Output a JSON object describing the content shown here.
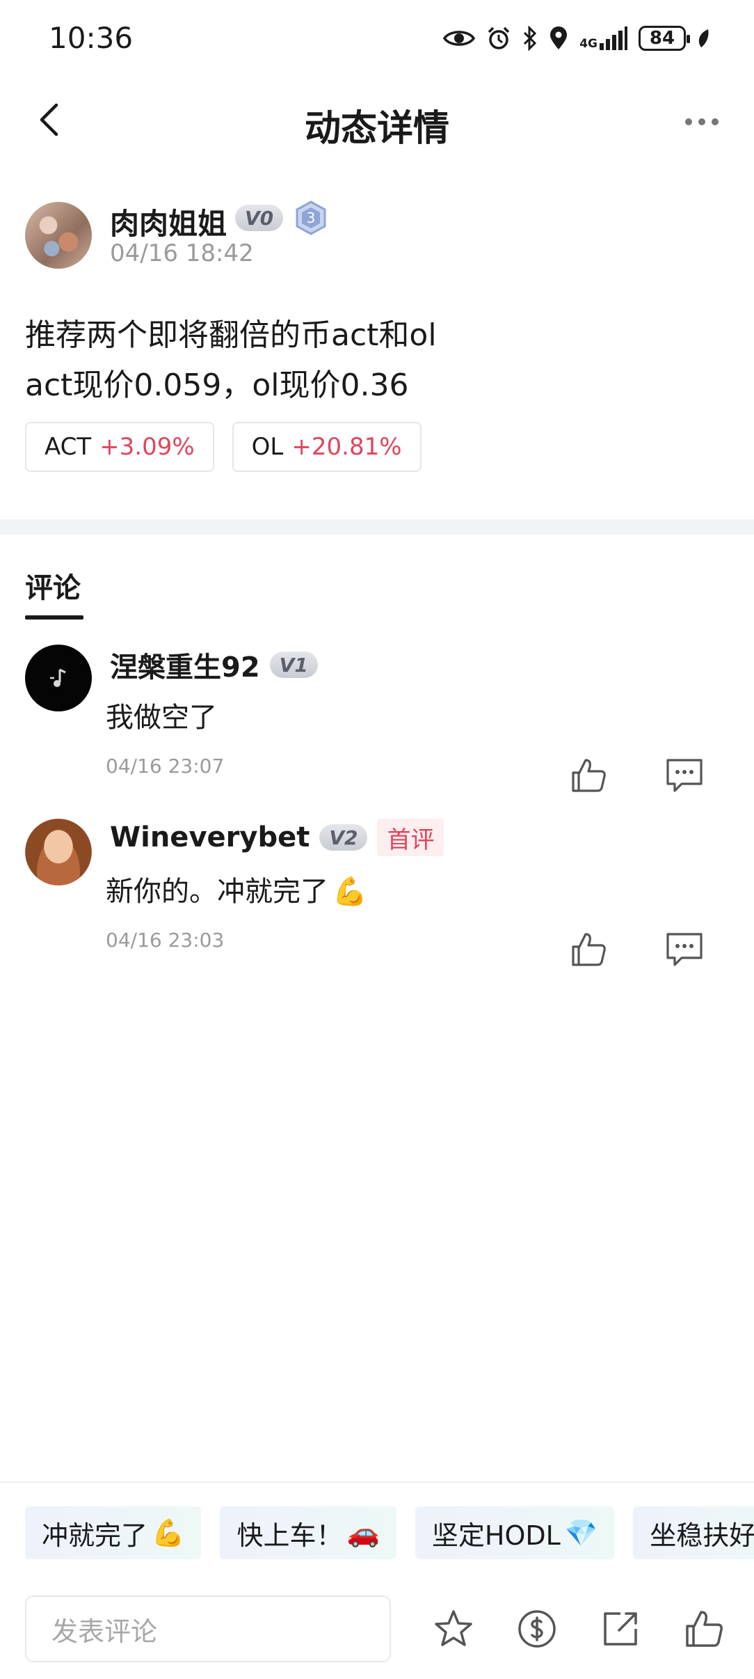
{
  "status": {
    "time": "10:36",
    "network": "4G",
    "battery": "84"
  },
  "header": {
    "title": "动态详情"
  },
  "post": {
    "author": {
      "name": "肉肉姐姐",
      "level": "V0",
      "rank": "3",
      "time": "04/16 18:42"
    },
    "lines": [
      "推荐两个即将翻倍的币act和ol",
      "act现价0.059，ol现价0.36"
    ],
    "tickers": [
      {
        "symbol": "ACT",
        "change": "+3.09%"
      },
      {
        "symbol": "OL",
        "change": "+20.81%"
      }
    ]
  },
  "comments_section": {
    "tab_label": "评论",
    "items": [
      {
        "name": "涅槃重生92",
        "level": "V1",
        "tag": "",
        "text": "我做空了",
        "time": "04/16 23:07"
      },
      {
        "name": "Wineverybet",
        "level": "V2",
        "tag": "首评",
        "text": "新你的。冲就完了",
        "emoji": "💪",
        "time": "04/16 23:03"
      }
    ]
  },
  "quick_replies": [
    {
      "text": "冲就完了",
      "emoji": "💪"
    },
    {
      "text": "快上车！",
      "emoji": "🚗"
    },
    {
      "text": "坚定HODL",
      "emoji": "💎"
    },
    {
      "text": "坐稳扶好",
      "emoji": ""
    }
  ],
  "bottom_bar": {
    "placeholder": "发表评论",
    "icons": [
      "star-icon",
      "coin-icon",
      "share-icon",
      "thumbs-up-icon"
    ]
  },
  "colors": {
    "up": "#e0455c",
    "text": "#1a1a1a",
    "muted": "#9a9a9a"
  }
}
